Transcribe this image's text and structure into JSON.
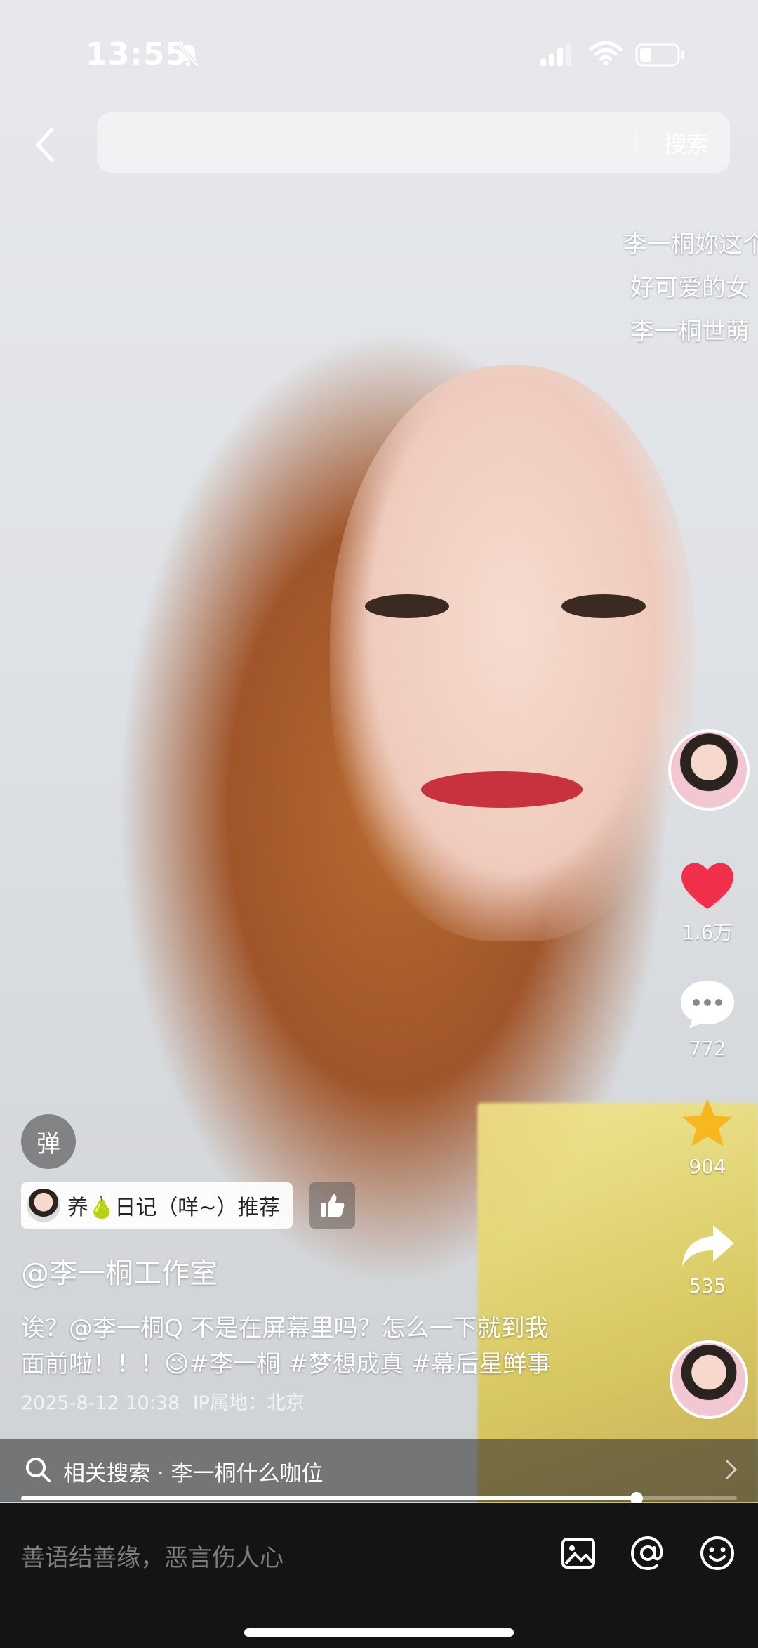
{
  "status_bar": {
    "time": "13:55"
  },
  "search": {
    "placeholder": "",
    "button_label": "搜索"
  },
  "danmaku": [
    "李一桐妳这个",
    "好可爱的女",
    "李一桐世萌"
  ],
  "actions": {
    "likes": "1.6万",
    "comments": "772",
    "favorites": "904",
    "shares": "535"
  },
  "danmaku_button": "弹",
  "recommend": {
    "text": "养🍐日记（咩~）推荐"
  },
  "post": {
    "author": "@李一桐工作室",
    "description_line1": "诶？@李一桐Q 不是在屏幕里吗？怎么一下就到我",
    "description_line2": "面前啦！！！😉#李一桐 #梦想成真 #幕后星鲜事",
    "date": "2025-8-12 10:38",
    "ip": "IP属地：北京"
  },
  "related_search": {
    "text": "相关搜索 · 李一桐什么咖位"
  },
  "progress": {
    "fraction": 0.86
  },
  "comment_input": {
    "placeholder": "善语结善缘，恶言伤人心"
  },
  "colors": {
    "like": "#f0304a",
    "favorite": "#f7b81f",
    "bottom_bar": "#141414"
  }
}
